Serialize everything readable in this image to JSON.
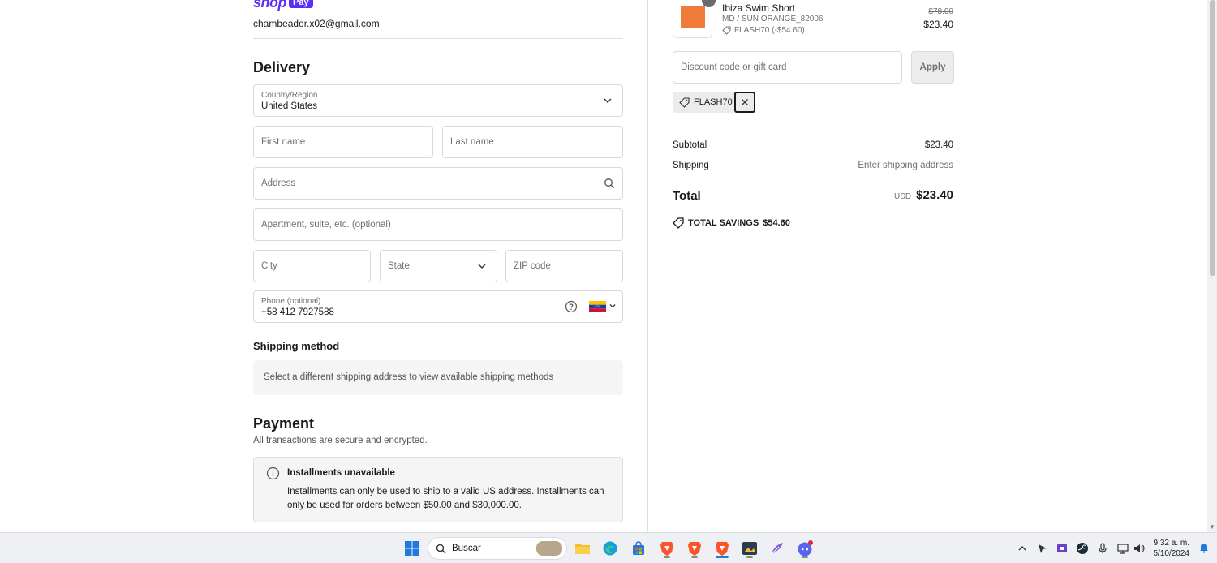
{
  "account": {
    "shop_word": "shop",
    "pay_badge": "Pay",
    "email": "chambeador.x02@gmail.com"
  },
  "delivery": {
    "title": "Delivery",
    "country_label": "Country/Region",
    "country_value": "United States",
    "first_name_placeholder": "First name",
    "last_name_placeholder": "Last name",
    "address_placeholder": "Address",
    "apartment_placeholder": "Apartment, suite, etc. (optional)",
    "city_placeholder": "City",
    "state_placeholder": "State",
    "zip_placeholder": "ZIP code",
    "phone_label": "Phone (optional)",
    "phone_value": "+58 412 7927588"
  },
  "shipping_method": {
    "title": "Shipping method",
    "message": "Select a different shipping address to view available shipping methods"
  },
  "payment": {
    "title": "Payment",
    "subtitle": "All transactions are secure and encrypted.",
    "notice_title": "Installments unavailable",
    "notice_body": "Installments can only be used to ship to a valid US address. Installments can only be used for orders between $50.00 and $30,000.00."
  },
  "order": {
    "product_name": "Ibiza Swim Short",
    "product_variant": "MD / SUN ORANGE_82006",
    "product_discount": "FLASH70 (-$54.60)",
    "price_original": "$78.00",
    "price_current": "$23.40",
    "discount_placeholder": "Discount code or gift card",
    "apply_label": "Apply",
    "applied_code": "FLASH70",
    "subtotal_label": "Subtotal",
    "subtotal_value": "$23.40",
    "shipping_label": "Shipping",
    "shipping_value": "Enter shipping address",
    "total_label": "Total",
    "total_currency": "USD",
    "total_value": "$23.40",
    "savings_label": "TOTAL SAVINGS",
    "savings_value": "$54.60"
  },
  "taskbar": {
    "search_label": "Buscar",
    "time": "9:32 a. m.",
    "date": "5/10/2024"
  },
  "colors": {
    "shop_purple": "#5a31f4",
    "product_orange": "#f07a3a",
    "flag_yellow": "#f4c400",
    "flag_blue": "#1f3c97",
    "flag_red": "#d0103a"
  }
}
